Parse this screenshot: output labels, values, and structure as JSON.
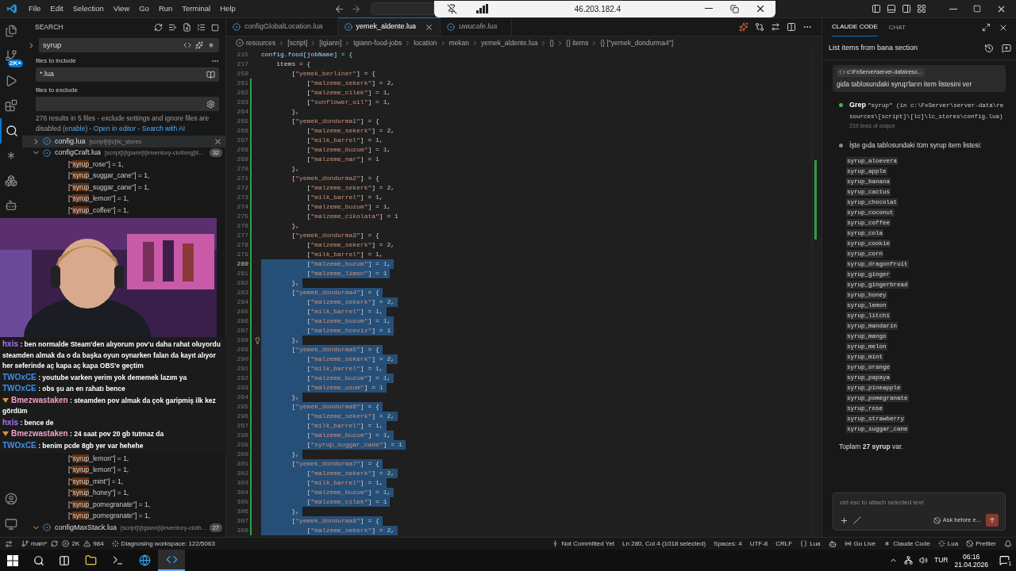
{
  "title_bar": {
    "menus": [
      "File",
      "Edit",
      "Selection",
      "View",
      "Go",
      "Run",
      "Terminal",
      "Help"
    ],
    "remote_address": "46.203.182.4"
  },
  "activity_bar": {
    "source_control_badge": "2K+"
  },
  "search": {
    "title": "SEARCH",
    "query": "syrup",
    "include_label": "files to include",
    "include": "*.lua",
    "exclude_label": "files to exclude",
    "message": [
      {
        "kind": "text",
        "text": "276 results in 5 files - exclude settings and ignore files are disabled ("
      },
      {
        "kind": "link",
        "text": "enable"
      },
      {
        "kind": "text",
        "text": ") - "
      },
      {
        "kind": "link",
        "text": "Open in editor"
      },
      {
        "kind": "text",
        "text": " - "
      },
      {
        "kind": "link",
        "text": "Search with AI"
      }
    ],
    "files_top": [
      {
        "name": "config.lua",
        "path": "[script]\\[lc]\\lc_stores",
        "expanded": false,
        "selected": true
      },
      {
        "name": "configCraft.lua",
        "path": "[script]\\[tgiann]\\[inventory-clothing]\\t...",
        "count": "32",
        "expanded": true,
        "selected": false
      }
    ],
    "results_top": [
      "[\"syrup_rose\"] = 1,",
      "[\"syrup_suggar_cane\"] = 1,",
      "[\"syrup_suggar_cane\"] = 1,",
      "[\"syrup_lemon\"] = 1,",
      "[\"syrup_coffee\"] = 1,"
    ],
    "results_bottom": [
      "[\"syrup_lemon\"] = 1,",
      "[\"syrup_lemon\"] = 1,",
      "[\"syrup_mint\"] = 1,",
      "[\"syrup_honey\"] = 1,",
      "[\"syrup_pomegranate\"] = 1,",
      "[\"syrup_pomegranate\"] = 1,"
    ],
    "files_bottom": [
      {
        "name": "configMaxStack.lua",
        "path": "[script]\\[tgiann]\\[inventory-cloth...",
        "count": "27",
        "expanded": true,
        "selected": false
      }
    ]
  },
  "stream_chat": [
    {
      "user": "hxis",
      "color": "#a970ff",
      "badge": false,
      "text": ": ben normalde Steam'den alıyorum pov'u daha rahat oluyordu steamden almak da o da başka oyun oynarken falan da kayıt alıyor her seferinde aç kapa aç kapa OBS'e geçtim"
    },
    {
      "user": "TWOxCE",
      "color": "#3a8fe8",
      "badge": false,
      "text": ": youtube varken yerim yok dememek lazım ya"
    },
    {
      "user": "TWOxCE",
      "color": "#3a8fe8",
      "badge": false,
      "text": ": obs şu an en rahatı bence"
    },
    {
      "user": "Bmezwastaken",
      "color": "#f0a0c8",
      "badge": true,
      "text": ": steamden pov almak da çok garipmiş ilk kez gördüm"
    },
    {
      "user": "hxis",
      "color": "#a970ff",
      "badge": false,
      "text": ": bence de"
    },
    {
      "user": "Bmezwastaken",
      "color": "#f0a0c8",
      "badge": true,
      "text": ": 24 saat pov 20 gb tutmaz da"
    },
    {
      "user": "TWOxCE",
      "color": "#3a8fe8",
      "badge": false,
      "text": ": benim pcde 8gb yer var hehehe"
    }
  ],
  "editor": {
    "tabs": [
      {
        "label": "configGlobalLocation.lua",
        "selected": false,
        "preview": false
      },
      {
        "label": "yemek_aldente.lua",
        "selected": true,
        "preview": false
      },
      {
        "label": "uwucafe.lua",
        "selected": false,
        "preview": true
      }
    ],
    "breadcrumb": [
      "resources",
      "[script]",
      "[tgiann]",
      "tgiann-food-jobs",
      "location",
      "mekan",
      "yemek_aldente.lua",
      "{}",
      "{} items",
      "{} [\"yemek_dondurma4\"]"
    ],
    "lines": [
      {
        "num": "215",
        "text": "config.food[jobName] = {",
        "selected": false
      },
      {
        "num": "217",
        "text": "    items = {",
        "selected": false
      },
      {
        "num": "259",
        "text": "        [\"yemek_berliner\"] = {",
        "selected": false
      },
      {
        "num": "261",
        "text": "            [\"malzeme_sekerk\"] = 2,",
        "selected": false
      },
      {
        "num": "262",
        "text": "            [\"malzeme_cilek\"] = 1,",
        "selected": false
      },
      {
        "num": "263",
        "text": "            [\"sunflower_oil\"] = 1,",
        "selected": false
      },
      {
        "num": "264",
        "text": "        },",
        "selected": false
      },
      {
        "num": "265",
        "text": "        [\"yemek_dondurma1\"] = {",
        "selected": false
      },
      {
        "num": "266",
        "text": "            [\"malzeme_sekerk\"] = 2,",
        "selected": false
      },
      {
        "num": "267",
        "text": "            [\"milk_barrel\"] = 1,",
        "selected": false
      },
      {
        "num": "268",
        "text": "            [\"malzeme_buzum\"] = 1,",
        "selected": false
      },
      {
        "num": "269",
        "text": "            [\"malzeme_nar\"] = 1",
        "selected": false
      },
      {
        "num": "270",
        "text": "        },",
        "selected": false
      },
      {
        "num": "271",
        "text": "        [\"yemek_dondurma2\"] = {",
        "selected": false
      },
      {
        "num": "272",
        "text": "            [\"malzeme_sekerk\"] = 2,",
        "selected": false
      },
      {
        "num": "273",
        "text": "            [\"milk_barrel\"] = 1,",
        "selected": false
      },
      {
        "num": "274",
        "text": "            [\"malzeme_buzum\"] = 1,",
        "selected": false
      },
      {
        "num": "275",
        "text": "            [\"malzeme_cikolata\"] = 1",
        "selected": false
      },
      {
        "num": "276",
        "text": "        },",
        "selected": false
      },
      {
        "num": "277",
        "text": "        [\"yemek_dondurma3\"] = {",
        "selected": false
      },
      {
        "num": "278",
        "text": "            [\"malzeme_sekerk\"] = 2,",
        "selected": false
      },
      {
        "num": "279",
        "text": "            [\"milk_barrel\"] = 1,",
        "selected": false
      },
      {
        "num": "280",
        "text": "            [\"malzeme_buzum\"] = 1,",
        "selected": true
      },
      {
        "num": "281",
        "text": "            [\"malzeme_limon\"] = 1",
        "selected": true
      },
      {
        "num": "282",
        "text": "        },",
        "selected": true
      },
      {
        "num": "283",
        "text": "        [\"yemek_dondurma4\"] = {",
        "selected": true
      },
      {
        "num": "284",
        "text": "            [\"malzeme_sekerk\"] = 2,",
        "selected": true
      },
      {
        "num": "285",
        "text": "            [\"milk_barrel\"] = 1,",
        "selected": true
      },
      {
        "num": "286",
        "text": "            [\"malzeme_buzum\"] = 1,",
        "selected": true
      },
      {
        "num": "287",
        "text": "            [\"malzeme_hceviz\"] = 1",
        "selected": true
      },
      {
        "num": "288",
        "text": "        },",
        "selected": true,
        "lightbulb": true
      },
      {
        "num": "289",
        "text": "        [\"yemek_dondurma5\"] = {",
        "selected": true
      },
      {
        "num": "290",
        "text": "            [\"malzeme_sekerk\"] = 2,",
        "selected": true
      },
      {
        "num": "291",
        "text": "            [\"milk_barrel\"] = 1,",
        "selected": true
      },
      {
        "num": "292",
        "text": "            [\"malzeme_buzum\"] = 1,",
        "selected": true
      },
      {
        "num": "293",
        "text": "            [\"malzeme_uzum\"] = 1",
        "selected": true
      },
      {
        "num": "294",
        "text": "        },",
        "selected": true
      },
      {
        "num": "295",
        "text": "        [\"yemek_dondurma6\"] = {",
        "selected": true
      },
      {
        "num": "296",
        "text": "            [\"malzeme_sekerk\"] = 2,",
        "selected": true
      },
      {
        "num": "297",
        "text": "            [\"milk_barrel\"] = 1,",
        "selected": true
      },
      {
        "num": "298",
        "text": "            [\"malzeme_buzum\"] = 1,",
        "selected": true
      },
      {
        "num": "299",
        "text": "            [\"syrup_suggar_cane\"] = 1",
        "selected": true
      },
      {
        "num": "300",
        "text": "        },",
        "selected": true
      },
      {
        "num": "301",
        "text": "        [\"yemek_dondurma7\"] = {",
        "selected": true
      },
      {
        "num": "302",
        "text": "            [\"malzeme_sekerk\"] = 2,",
        "selected": true
      },
      {
        "num": "303",
        "text": "            [\"milk_barrel\"] = 1,",
        "selected": true
      },
      {
        "num": "304",
        "text": "            [\"malzeme_buzum\"] = 1,",
        "selected": true
      },
      {
        "num": "305",
        "text": "            [\"malzeme_cilek\"] = 1",
        "selected": true
      },
      {
        "num": "306",
        "text": "        },",
        "selected": true
      },
      {
        "num": "307",
        "text": "        [\"yemek_dondurma8\"] = {",
        "selected": true
      },
      {
        "num": "308",
        "text": "            [\"malzeme_sekerk\"] = 2,",
        "selected": true
      }
    ]
  },
  "assistant": {
    "tabs": [
      {
        "label": "CLAUDE CODE",
        "selected": true
      },
      {
        "label": "CHAT",
        "selected": false
      }
    ],
    "title": "List items from bana section",
    "user_message": {
      "attachment": "c:\\FxServer\\server-data\\reso...",
      "text": "gida tablosundaki syrup'ların item listesini ver"
    },
    "tool": {
      "name": "Grep",
      "args": "\"syrup\" (in c:\\FxServer\\server-data\\resources\\[script]\\[lc]\\lc_stores\\config.lua)",
      "output": "219 lines of output"
    },
    "intro": "İşte gıda tablosundaki tüm syrup item listesi:",
    "items": [
      "syrup_aloevera",
      "syrup_apple",
      "syrup_banana",
      "syrup_cactus",
      "syrup_chocolat",
      "syrup_coconut",
      "syrup_coffee",
      "syrup_cola",
      "syrup_cookie",
      "syrup_corn",
      "syrup_dragonfruit",
      "syrup_ginger",
      "syrup_gingerbread",
      "syrup_honey",
      "syrup_lemon",
      "syrup_litchi",
      "syrup_mandarin",
      "syrup_mango",
      "syrup_melon",
      "syrup_mint",
      "syrup_orange",
      "syrup_papaya",
      "syrup_pineapple",
      "syrup_pomegranate",
      "syrup_rose",
      "syrup_strawberry",
      "syrup_suggar_cane"
    ],
    "summary": "Toplam **27 syrup** var.",
    "input_placeholder": "ctrl esc to attach selected text",
    "mode": "Ask before e..."
  },
  "status_bar": {
    "branch": "main*",
    "errors": "2K",
    "warnings": "984",
    "task": "Diagnosing workspace: 122/5063",
    "blame": "Not Committed Yet",
    "cursor": "Ln 280, Col 4 (1018 selected)",
    "indent": "Spaces: 4",
    "encoding": "UTF-8",
    "eol": "CRLF",
    "language": "Lua",
    "live": "Go Live",
    "claude": "Claude Code",
    "lua_server": "Lua",
    "formatter": "Prettier"
  },
  "taskbar": {
    "language": "TUR",
    "time": "06:16",
    "date": "21.04.2026",
    "notifications": "1"
  }
}
